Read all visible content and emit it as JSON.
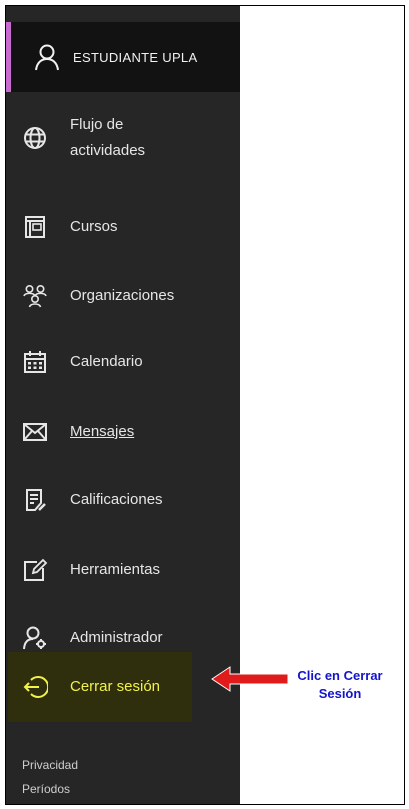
{
  "user": {
    "name": "ESTUDIANTE UPLA"
  },
  "nav": {
    "activity": "Flujo de actividades",
    "courses": "Cursos",
    "organizations": "Organizaciones",
    "calendar": "Calendario",
    "messages": "Mensajes",
    "grades": "Calificaciones",
    "tools": "Herramientas",
    "admin": "Administrador",
    "logout": "Cerrar sesión"
  },
  "footer": {
    "privacy": "Privacidad",
    "periods": "Períodos"
  },
  "annotation": {
    "line1": "Clic en Cerrar",
    "line2": "Sesión"
  },
  "colors": {
    "sidebar": "#262626",
    "profile_bg": "#121212",
    "accent": "#c86bd1",
    "logout_text": "#f2f24a",
    "arrow": "#e01b1b",
    "callout": "#1414cc"
  }
}
